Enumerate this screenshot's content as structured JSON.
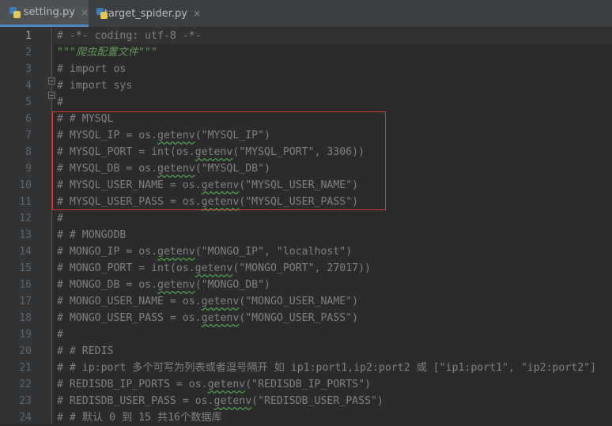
{
  "tabs": [
    {
      "label": "setting.py",
      "icon": "python-file-icon",
      "active": true
    },
    {
      "label": "target_spider.py",
      "icon": "python-file-icon",
      "active": false
    }
  ],
  "close_glyph": "×",
  "lines": [
    {
      "n": "1",
      "text": "# -*- coding: utf-8 -*-"
    },
    {
      "n": "2",
      "text": "\"\"\"爬虫配置文件\"\"\""
    },
    {
      "n": "3",
      "text": "# import os"
    },
    {
      "n": "4",
      "text": "# import sys"
    },
    {
      "n": "5",
      "text": "#"
    },
    {
      "n": "6",
      "text": "# # MYSQL"
    },
    {
      "n": "7",
      "text": "# MYSQL_IP = os.getenv(\"MYSQL_IP\")"
    },
    {
      "n": "8",
      "text": "# MYSQL_PORT = int(os.getenv(\"MYSQL_PORT\", 3306))"
    },
    {
      "n": "9",
      "text": "# MYSQL_DB = os.getenv(\"MYSQL_DB\")"
    },
    {
      "n": "10",
      "text": "# MYSQL_USER_NAME = os.getenv(\"MYSQL_USER_NAME\")"
    },
    {
      "n": "11",
      "text": "# MYSQL_USER_PASS = os.getenv(\"MYSQL_USER_PASS\")"
    },
    {
      "n": "12",
      "text": "#"
    },
    {
      "n": "13",
      "text": "# # MONGODB"
    },
    {
      "n": "14",
      "text": "# MONGO_IP = os.getenv(\"MONGO_IP\", \"localhost\")"
    },
    {
      "n": "15",
      "text": "# MONGO_PORT = int(os.getenv(\"MONGO_PORT\", 27017))"
    },
    {
      "n": "16",
      "text": "# MONGO_DB = os.getenv(\"MONGO_DB\")"
    },
    {
      "n": "17",
      "text": "# MONGO_USER_NAME = os.getenv(\"MONGO_USER_NAME\")"
    },
    {
      "n": "18",
      "text": "# MONGO_USER_PASS = os.getenv(\"MONGO_USER_PASS\")"
    },
    {
      "n": "19",
      "text": "#"
    },
    {
      "n": "20",
      "text": "# # REDIS"
    },
    {
      "n": "21",
      "text": "# # ip:port 多个可写为列表或者逗号隔开 如 ip1:port1,ip2:port2 或 [\"ip1:port1\", \"ip2:port2\"]"
    },
    {
      "n": "22",
      "text": "# REDISDB_IP_PORTS = os.getenv(\"REDISDB_IP_PORTS\")"
    },
    {
      "n": "23",
      "text": "# REDISDB_USER_PASS = os.getenv(\"REDISDB_USER_PASS\")"
    },
    {
      "n": "24",
      "text": "# # 默认 0 到 15 共16个数据库"
    }
  ],
  "colors": {
    "background": "#2b2b2b",
    "comment": "#808080",
    "docstring": "#629755",
    "annotation_box": "#d83a3a",
    "active_tab_underline": "#4a88c7"
  }
}
